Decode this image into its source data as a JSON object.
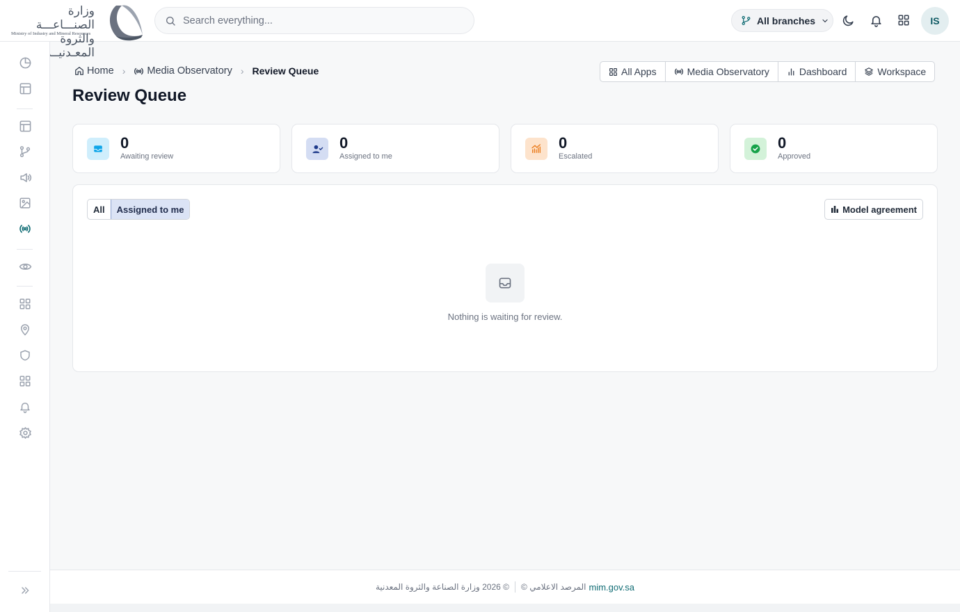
{
  "header": {
    "logo_ar_line1": "وزارة الصنـــاعـــة",
    "logo_ar_line2": "والثروة المعـدنيــة",
    "logo_en": "Ministry of Industry and Mineral Resources",
    "search_placeholder": "Search everything...",
    "branch_label": "All branches",
    "avatar_initials": "IS",
    "icons": [
      "search-icon",
      "git-branch-icon",
      "chevron-down-icon",
      "moon-icon",
      "bell-icon",
      "grid-icon"
    ]
  },
  "sidebar": {
    "items": [
      {
        "icon": "pie-chart-icon",
        "active": false
      },
      {
        "icon": "layout-icon",
        "active": false
      },
      {
        "icon": "layout-icon",
        "active": false
      },
      {
        "icon": "git-branch-icon",
        "active": false
      },
      {
        "icon": "megaphone-icon",
        "active": false
      },
      {
        "icon": "image-icon",
        "active": false
      },
      {
        "icon": "radio-broadcast-icon",
        "active": true
      },
      {
        "icon": "eye-icon",
        "active": false
      },
      {
        "icon": "grid-icon",
        "active": false
      },
      {
        "icon": "map-pin-icon",
        "active": false
      },
      {
        "icon": "shield-icon",
        "active": false
      },
      {
        "icon": "grid-icon",
        "active": false
      },
      {
        "icon": "bell-icon",
        "active": false
      },
      {
        "icon": "gear-icon",
        "active": false
      }
    ],
    "expand_icon": "chevrons-right-icon"
  },
  "breadcrumb": {
    "home": "Home",
    "section": "Media Observatory",
    "current": "Review Queue"
  },
  "app_links": {
    "all_apps": "All Apps",
    "media_observatory": "Media Observatory",
    "dashboard": "Dashboard",
    "workspace": "Workspace"
  },
  "page_title": "Review Queue",
  "stats": [
    {
      "value": "0",
      "label": "Awaiting review",
      "icon": "inbox-icon",
      "color": "#0ea5e9"
    },
    {
      "value": "0",
      "label": "Assigned to me",
      "icon": "user-check-icon",
      "color": "#1e3a8a"
    },
    {
      "value": "0",
      "label": "Escalated",
      "icon": "trend-up-icon",
      "color": "#ea7a1a"
    },
    {
      "value": "0",
      "label": "Approved",
      "icon": "check-circle-icon",
      "color": "#16a34a"
    }
  ],
  "panel": {
    "tab_all": "All",
    "tab_assigned": "Assigned to me",
    "active_tab": "Assigned to me",
    "agreement_button": "Model agreement",
    "empty_text": "Nothing is waiting for review."
  },
  "footer": {
    "copyright_ar": "© 2026 وزارة الصناعة والثروة المعدنية",
    "observatory_ar": "المرصد الاعلامي ©",
    "link": "mim.gov.sa"
  },
  "colors": {
    "accent": "#0f6b73",
    "active_tab_bg": "#dbe3f5"
  }
}
